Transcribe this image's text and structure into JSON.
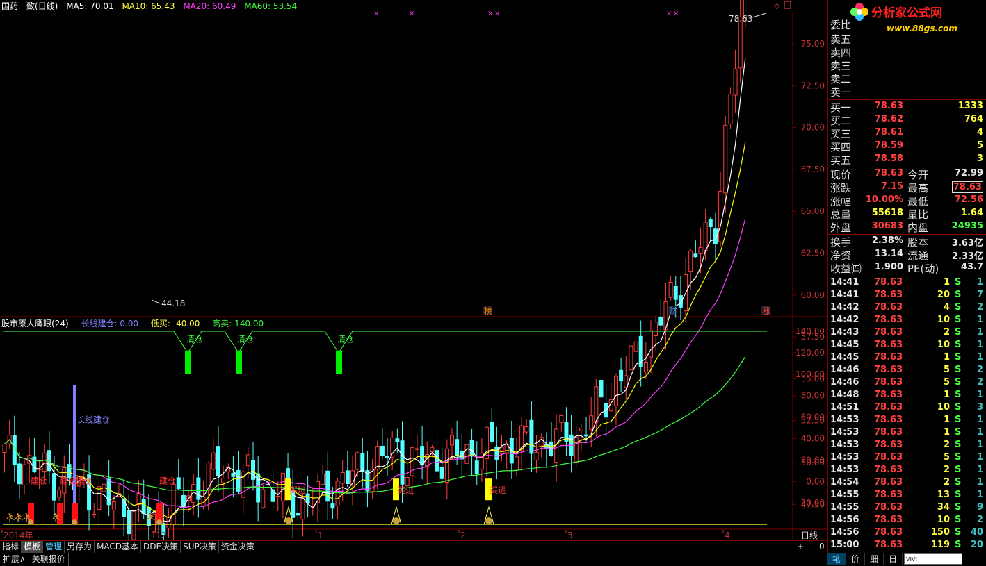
{
  "header": {
    "title": "国药一致(日线)",
    "ma5": "MA5: 70.01",
    "ma10": "MA10: 65.43",
    "ma20": "MA20: 60.49",
    "ma60": "MA60: 53.54",
    "colors": {
      "ma5": "#ffffff",
      "ma10": "#ffff00",
      "ma20": "#ff00ff",
      "ma60": "#00ff00"
    }
  },
  "price_axis": [
    "75.00",
    "72.50",
    "70.00",
    "67.50",
    "65.00",
    "62.50",
    "60.00",
    "57.50",
    "55.00",
    "52.50",
    "50.00",
    "47.50",
    "45.00"
  ],
  "price_marks": {
    "high": "78.63",
    "low": "44.18"
  },
  "event_markers": [
    "榜",
    "财",
    "涨"
  ],
  "indicator": {
    "name": "股市原人鹰眼(24)",
    "longline": "长线建仓: 0.00",
    "low_buy": "低买: -40.00",
    "high_sell": "高卖: 140.00",
    "axis": [
      "140.00",
      "120.00",
      "100.00",
      "80.00",
      "60.00",
      "40.00",
      "20.00",
      "0.00",
      "-20.00"
    ],
    "clear_label": "清仓",
    "build_label": "建仓",
    "long_label": "长线建仓",
    "buy_label": "买进"
  },
  "date_axis": [
    "2014年",
    "12",
    "1",
    "2",
    "3",
    "4"
  ],
  "period_label": "日线",
  "bottom_tabs": [
    "指标",
    "模板",
    "管理",
    "另存为",
    "MACD基本",
    "DDE决策",
    "SUP决策",
    "资金决策"
  ],
  "ext_tabs": [
    "扩展∧",
    "关联报价"
  ],
  "zoom": [
    "+",
    "-",
    "0"
  ],
  "logo": {
    "text": "分析家公式网",
    "url": "www.88gs.com"
  },
  "order_book": {
    "header": "委比",
    "asks": [
      {
        "label": "卖五",
        "price": "",
        "vol": ""
      },
      {
        "label": "卖四",
        "price": "",
        "vol": ""
      },
      {
        "label": "卖三",
        "price": "",
        "vol": ""
      },
      {
        "label": "卖二",
        "price": "",
        "vol": ""
      },
      {
        "label": "卖一",
        "price": "",
        "vol": ""
      }
    ],
    "bids": [
      {
        "label": "买一",
        "price": "78.63",
        "vol": "1333"
      },
      {
        "label": "买二",
        "price": "78.62",
        "vol": "764"
      },
      {
        "label": "买三",
        "price": "78.61",
        "vol": "4"
      },
      {
        "label": "买四",
        "price": "78.59",
        "vol": "5"
      },
      {
        "label": "买五",
        "price": "78.58",
        "vol": "3"
      }
    ]
  },
  "quote": [
    {
      "l1": "现价",
      "v1": "78.63",
      "l2": "今开",
      "v2": "72.99"
    },
    {
      "l1": "涨跌",
      "v1": "7.15",
      "l2": "最高",
      "v2": "78.63"
    },
    {
      "l1": "涨幅",
      "v1": "10.00%",
      "l2": "最低",
      "v2": "72.56"
    },
    {
      "l1": "总量",
      "v1": "55618",
      "l2": "量比",
      "v2": "1.64"
    },
    {
      "l1": "外盘",
      "v1": "30683",
      "l2": "内盘",
      "v2": "24935"
    }
  ],
  "finance": [
    {
      "l1": "换手",
      "v1": "2.38%",
      "l2": "股本",
      "v2": "3.63亿"
    },
    {
      "l1": "净资",
      "v1": "13.14",
      "l2": "流通",
      "v2": "2.33亿"
    },
    {
      "l1": "收益㈣",
      "v1": "1.900",
      "l2": "PE(动)",
      "v2": "43.7"
    }
  ],
  "ticks": [
    {
      "t": "14:41",
      "p": "78.63",
      "v": "1",
      "s": "S",
      "n": "1"
    },
    {
      "t": "14:41",
      "p": "78.63",
      "v": "20",
      "s": "S",
      "n": "7"
    },
    {
      "t": "14:42",
      "p": "78.63",
      "v": "4",
      "s": "S",
      "n": "2"
    },
    {
      "t": "14:42",
      "p": "78.63",
      "v": "10",
      "s": "S",
      "n": "1"
    },
    {
      "t": "14:43",
      "p": "78.63",
      "v": "2",
      "s": "S",
      "n": "1"
    },
    {
      "t": "14:45",
      "p": "78.63",
      "v": "10",
      "s": "S",
      "n": "1"
    },
    {
      "t": "14:45",
      "p": "78.63",
      "v": "1",
      "s": "S",
      "n": "1"
    },
    {
      "t": "14:46",
      "p": "78.63",
      "v": "5",
      "s": "S",
      "n": "2"
    },
    {
      "t": "14:46",
      "p": "78.63",
      "v": "5",
      "s": "S",
      "n": "2"
    },
    {
      "t": "14:48",
      "p": "78.63",
      "v": "1",
      "s": "S",
      "n": "1"
    },
    {
      "t": "14:51",
      "p": "78.63",
      "v": "10",
      "s": "S",
      "n": "3"
    },
    {
      "t": "14:53",
      "p": "78.63",
      "v": "1",
      "s": "S",
      "n": "1"
    },
    {
      "t": "14:53",
      "p": "78.63",
      "v": "1",
      "s": "S",
      "n": "1"
    },
    {
      "t": "14:53",
      "p": "78.63",
      "v": "2",
      "s": "S",
      "n": "1"
    },
    {
      "t": "14:53",
      "p": "78.63",
      "v": "5",
      "s": "S",
      "n": "1"
    },
    {
      "t": "14:53",
      "p": "78.63",
      "v": "2",
      "s": "S",
      "n": "1"
    },
    {
      "t": "14:54",
      "p": "78.63",
      "v": "2",
      "s": "S",
      "n": "1"
    },
    {
      "t": "14:55",
      "p": "78.63",
      "v": "13",
      "s": "S",
      "n": "1"
    },
    {
      "t": "14:55",
      "p": "78.63",
      "v": "34",
      "s": "S",
      "n": "9"
    },
    {
      "t": "14:56",
      "p": "78.63",
      "v": "10",
      "s": "S",
      "n": "2"
    },
    {
      "t": "14:56",
      "p": "78.63",
      "v": "150",
      "s": "S",
      "n": "40"
    },
    {
      "t": "15:00",
      "p": "78.63",
      "v": "119",
      "s": "S",
      "n": "20"
    }
  ],
  "right_tabs": [
    "笔",
    "价",
    "细",
    "日"
  ],
  "search_value": "vivi"
}
